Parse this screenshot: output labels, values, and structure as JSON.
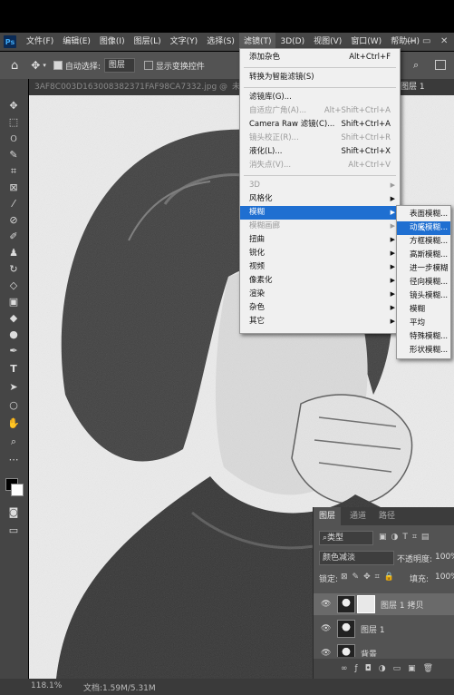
{
  "app": {
    "logo": "Ps"
  },
  "menubar": {
    "items": [
      "文件(F)",
      "编辑(E)",
      "图像(I)",
      "图层(L)",
      "文字(Y)",
      "选择(S)",
      "滤镜(T)",
      "3D(D)",
      "视图(V)",
      "窗口(W)",
      "帮助(H)"
    ],
    "win_min": "—",
    "win_max": "▭",
    "win_close": "✕"
  },
  "options": {
    "autoselect_label": "自动选择:",
    "autoselect_value": "图层",
    "transform_label": "显示变换控件",
    "search_icon": "search-icon"
  },
  "tabs": {
    "doc1": "3AF8C003D163008382371FAF98CA7332.jpg @",
    "doc2": "未标",
    "doc3": "图层 1"
  },
  "filter_menu": {
    "items": [
      {
        "label": "添加杂色",
        "shortcut": "Alt+Ctrl+F",
        "disabled": false
      },
      {
        "sep": true
      },
      {
        "label": "转换为智能滤镜(S)",
        "shortcut": "",
        "disabled": false
      },
      {
        "sep": true
      },
      {
        "label": "滤镜库(G)...",
        "shortcut": "",
        "disabled": false
      },
      {
        "label": "自适应广角(A)...",
        "shortcut": "Alt+Shift+Ctrl+A",
        "disabled": true
      },
      {
        "label": "Camera Raw 滤镜(C)...",
        "shortcut": "Shift+Ctrl+A",
        "disabled": false
      },
      {
        "label": "镜头校正(R)...",
        "shortcut": "Shift+Ctrl+R",
        "disabled": true
      },
      {
        "label": "液化(L)...",
        "shortcut": "Shift+Ctrl+X",
        "disabled": false
      },
      {
        "label": "消失点(V)...",
        "shortcut": "Alt+Ctrl+V",
        "disabled": true
      },
      {
        "sep": true
      },
      {
        "label": "3D",
        "submenu": true,
        "disabled": true
      },
      {
        "label": "风格化",
        "submenu": true,
        "disabled": false
      },
      {
        "label": "模糊",
        "submenu": true,
        "disabled": false,
        "highlight": true
      },
      {
        "label": "模糊画廊",
        "submenu": true,
        "disabled": true
      },
      {
        "label": "扭曲",
        "submenu": true,
        "disabled": false
      },
      {
        "label": "锐化",
        "submenu": true,
        "disabled": false
      },
      {
        "label": "视频",
        "submenu": true,
        "disabled": false
      },
      {
        "label": "像素化",
        "submenu": true,
        "disabled": false
      },
      {
        "label": "渲染",
        "submenu": true,
        "disabled": false
      },
      {
        "label": "杂色",
        "submenu": true,
        "disabled": false
      },
      {
        "label": "其它",
        "submenu": true,
        "disabled": false
      }
    ]
  },
  "blur_submenu": {
    "items": [
      {
        "label": "表面模糊..."
      },
      {
        "label": "动感模糊...",
        "highlight": true
      },
      {
        "label": "方框模糊..."
      },
      {
        "label": "高斯模糊..."
      },
      {
        "label": "进一步模糊"
      },
      {
        "label": "径向模糊..."
      },
      {
        "label": "镜头模糊..."
      },
      {
        "label": "模糊"
      },
      {
        "label": "平均"
      },
      {
        "label": "特殊模糊..."
      },
      {
        "label": "形状模糊..."
      }
    ]
  },
  "layers": {
    "tabs": [
      "图层",
      "通道",
      "路径"
    ],
    "kind": "类型",
    "blend": "颜色减淡",
    "opacity_label": "不透明度:",
    "opacity_value": "100%",
    "lock_label": "锁定:",
    "fill_label": "填充:",
    "fill_value": "100%",
    "rows": [
      {
        "name": "图层 1 拷贝"
      },
      {
        "name": "图层 1"
      },
      {
        "name": "背景"
      }
    ]
  },
  "status": {
    "zoom": "118.1%",
    "doc": "文档:1.59M/5.31M"
  }
}
